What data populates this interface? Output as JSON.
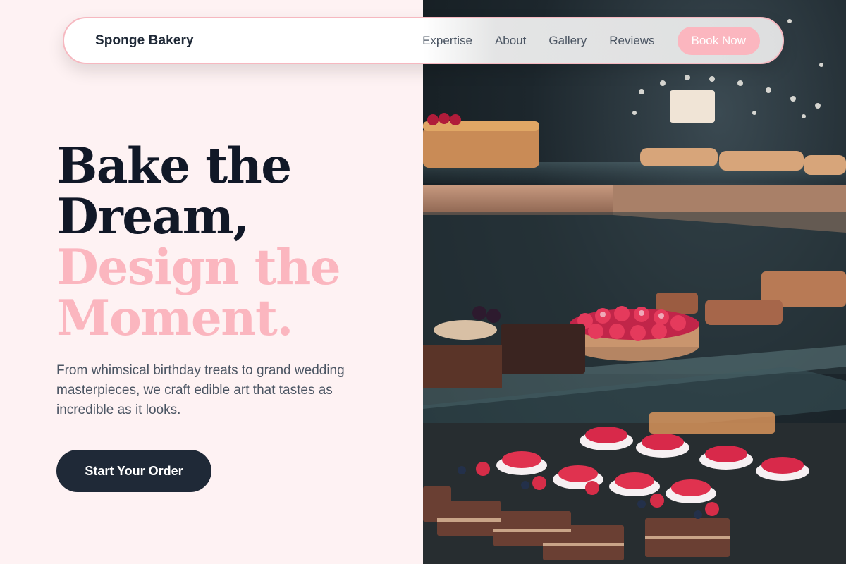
{
  "brand": {
    "name": "Sponge Bakery"
  },
  "nav": {
    "items": [
      {
        "label": "Expertise"
      },
      {
        "label": "About"
      },
      {
        "label": "Gallery"
      },
      {
        "label": "Reviews"
      }
    ],
    "cta_label": "Book Now"
  },
  "hero": {
    "headline_line1": "Bake the",
    "headline_line2": "Dream,",
    "headline_line3": "Design the",
    "headline_line4": "Moment.",
    "subtitle": "From whimsical birthday treats to grand wedding masterpieces, we craft edible art that tastes as incredible as it looks.",
    "cta_label": "Start Your Order"
  },
  "colors": {
    "background": "#fef2f3",
    "accent_pink": "#fbb6bf",
    "dark": "#1f2937",
    "nav_border": "#f6b8c0"
  },
  "image": {
    "subject": "bakery display case with cakes and pastries"
  }
}
